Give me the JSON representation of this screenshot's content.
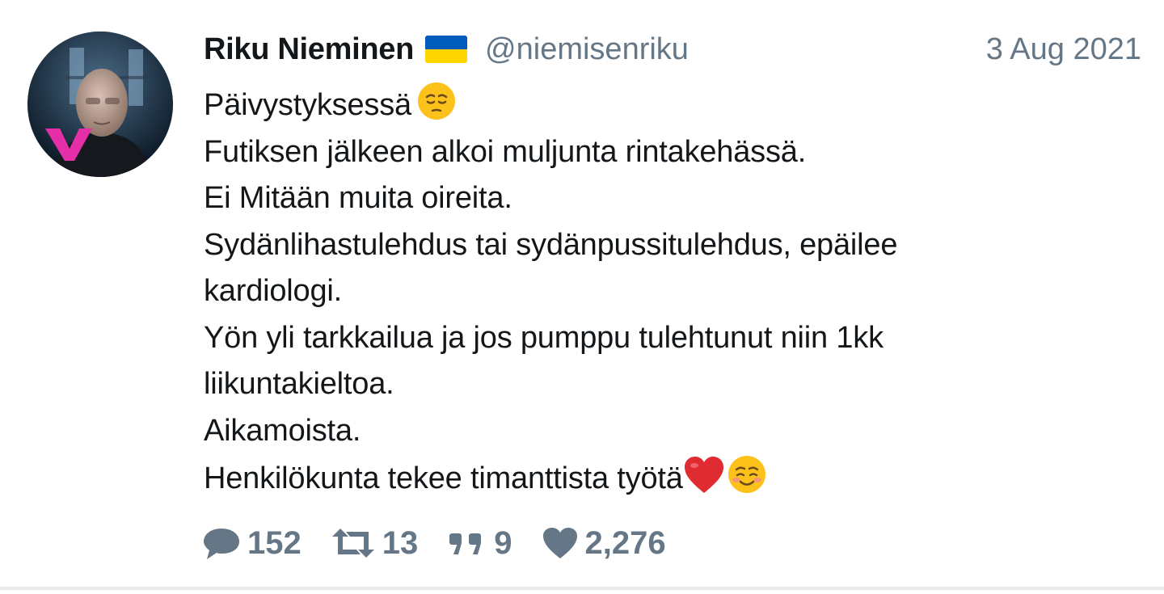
{
  "tweet": {
    "author": {
      "display_name": "Riku Nieminen",
      "flag": "ukraine-flag",
      "handle": "@niemisenriku"
    },
    "date": "3 Aug 2021",
    "lines": [
      "Päivystyksessä",
      "Futiksen jälkeen alkoi muljunta rintakehässä.",
      "Ei Mitään muita oireita.",
      "Sydänlihastulehdus tai sydänpussitulehdus, epäilee",
      "kardiologi.",
      "Yön yli tarkkailua ja jos pumppu tulehtunut niin 1kk",
      "liikuntakieltoa.",
      "Aikamoista.",
      "Henkilökunta tekee timanttista työtä"
    ],
    "emojis": {
      "line1": "pensive-face-emoji",
      "last_line": [
        "red-heart-emoji",
        "smiling-face-emoji"
      ]
    },
    "stats": {
      "replies": "152",
      "retweets": "13",
      "quotes": "9",
      "likes": "2,276"
    }
  },
  "colors": {
    "text": "#14171a",
    "secondary": "#657786",
    "divider": "#e6ecf0",
    "flag_blue": "#005bbb",
    "flag_yellow": "#ffd500"
  }
}
